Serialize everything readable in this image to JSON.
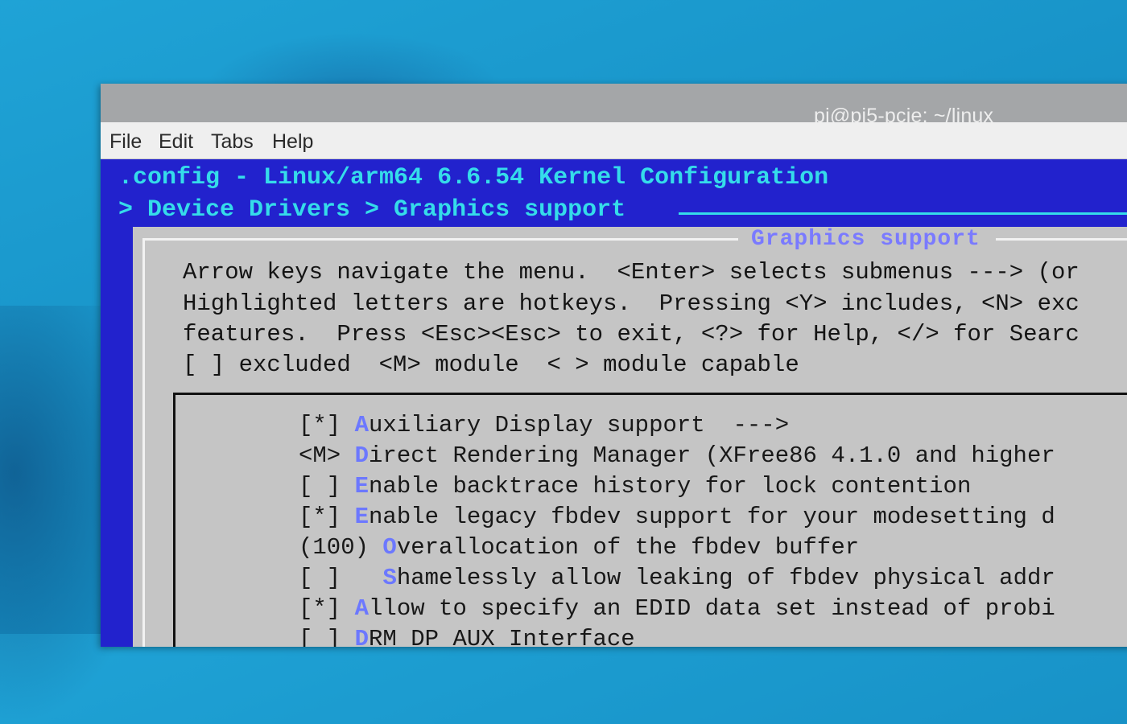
{
  "window": {
    "title": "pi@pi5-pcie: ~/linux"
  },
  "menubar": {
    "items": [
      "File",
      "Edit",
      "Tabs",
      "Help"
    ]
  },
  "config": {
    "header": ".config - Linux/arm64 6.6.54 Kernel Configuration",
    "breadcrumb": "> Device Drivers > Graphics support",
    "dialog_title": "Graphics support",
    "help_lines": [
      "Arrow keys navigate the menu.  <Enter> selects submenus ---> (or",
      "Highlighted letters are hotkeys.  Pressing <Y> includes, <N> exc",
      "features.  Press <Esc><Esc> to exit, <?> for Help, </> for Searc",
      "[ ] excluded  <M> module  < > module capable"
    ],
    "entries": [
      {
        "state": "[*]",
        "indent": " ",
        "hotkey": "A",
        "rest": "uxiliary Display support  --->"
      },
      {
        "state": "<M>",
        "indent": " ",
        "hotkey": "D",
        "rest": "irect Rendering Manager (XFree86 4.1.0 and higher"
      },
      {
        "state": "[ ]",
        "indent": " ",
        "hotkey": "E",
        "rest": "nable backtrace history for lock contention"
      },
      {
        "state": "[*]",
        "indent": " ",
        "hotkey": "E",
        "rest": "nable legacy fbdev support for your modesetting d"
      },
      {
        "state": "(100)",
        "indent": " ",
        "hotkey": "O",
        "rest": "verallocation of the fbdev buffer"
      },
      {
        "state": "[ ]",
        "indent": "   ",
        "hotkey": "S",
        "rest": "hamelessly allow leaking of fbdev physical addr"
      },
      {
        "state": "[*]",
        "indent": " ",
        "hotkey": "A",
        "rest": "llow to specify an EDID data set instead of probi"
      },
      {
        "state": "[ ]",
        "indent": " ",
        "hotkey": "D",
        "rest": "RM DP AUX Interface"
      }
    ]
  }
}
